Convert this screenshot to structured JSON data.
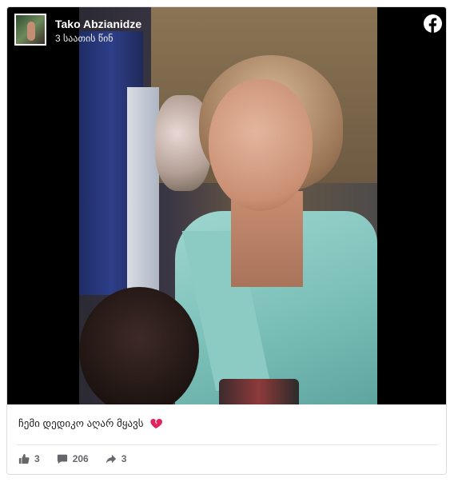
{
  "post": {
    "author": "Tako Abzianidze",
    "time": "3 საათის წინ",
    "caption": "ჩემი დედიკო აღარ მყავს",
    "caption_emoji": "broken-heart-icon"
  },
  "stats": {
    "likes": "3",
    "comments": "206",
    "shares": "3"
  },
  "icons": {
    "platform": "facebook-icon",
    "like": "thumbs-up-icon",
    "comment": "comment-icon",
    "share": "share-arrow-icon"
  },
  "colors": {
    "facebook": "#ffffff",
    "stat_text": "#65676b",
    "heart": "#e0245e"
  }
}
